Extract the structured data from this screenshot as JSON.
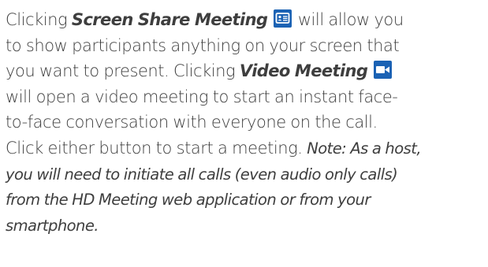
{
  "paragraph": {
    "line1_before": "Clicking ",
    "screen_share_label": "Screen Share Meeting",
    "line1_after": " will allow you",
    "line2": "to show participants anything on your screen that",
    "line3_before": "you want to present. Clicking ",
    "video_meeting_label": "Video Meeting",
    "line4": "will open a video meeting to start an instant face-",
    "line5": "to-face conversation with everyone on the call.",
    "line6_before": "Click either button to start a meeting. ",
    "line6_note": "Note: As a host,",
    "line7": "you will need to initiate all calls (even audio only calls)",
    "line8": "from the HD Meeting web application or from your",
    "line9": "smartphone."
  },
  "icons": {
    "screen_share": "screen-share-icon",
    "video_meeting": "video-camera-icon"
  },
  "colors": {
    "text": "#3e3e3e",
    "icon_bg": "#1b62b4",
    "icon_fg": "#ffffff"
  }
}
